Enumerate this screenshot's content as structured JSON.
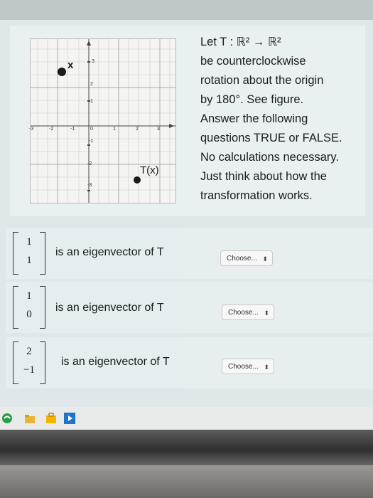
{
  "prompt": {
    "lines": [
      "Let T : ℝ² → ℝ²",
      "be counterclockwise",
      "rotation about the origin",
      "by 180°.   See figure.",
      "Answer the following",
      "questions TRUE or FALSE.",
      "No calculations necessary.",
      "Just think about how the",
      "transformation works."
    ]
  },
  "figure": {
    "x_label": "x",
    "tx_label": "T(x)",
    "x_ticks": [
      "-3",
      "-2",
      "-1",
      "0",
      "1",
      "2",
      "3"
    ],
    "y_ticks": [
      "3",
      "2",
      "1",
      "-1",
      "-2",
      "-3"
    ]
  },
  "questions": [
    {
      "vector": [
        "1",
        "1"
      ],
      "label": "is an eigenvector of T",
      "choice": "Choose...",
      "arrows": "⬍"
    },
    {
      "vector": [
        "1",
        "0"
      ],
      "label": "is an eigenvector of T",
      "choice": "Choose...",
      "arrows": "⬍"
    },
    {
      "vector": [
        "2",
        "−1"
      ],
      "label": "is an eigenvector of T",
      "choice": "Choose...",
      "arrows": "⬍"
    }
  ]
}
